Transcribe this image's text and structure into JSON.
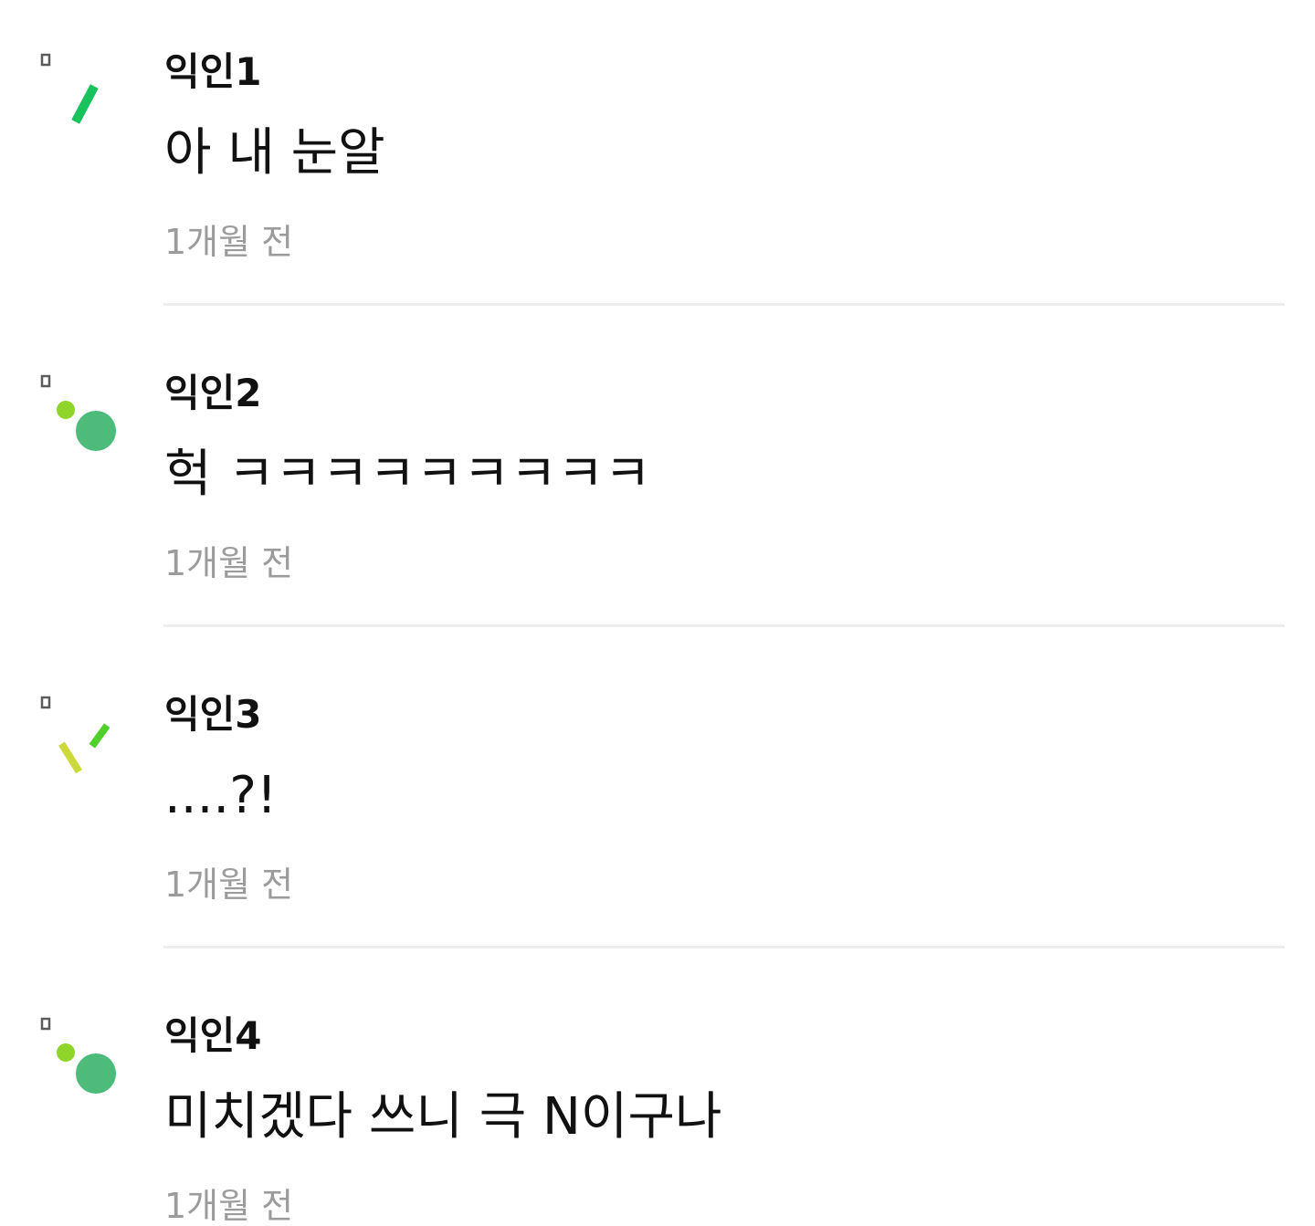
{
  "colors": {
    "author": "#111111",
    "body": "#111111",
    "time": "#9b9b9b",
    "divider": "#eeeeee",
    "avatar_green": "#18c25d",
    "avatar_teal": "#4dbb7a",
    "avatar_lime": "#8fd42a",
    "avatar_yellow": "#cdd93a",
    "avatar_corner": "#5a5a5a"
  },
  "comments": [
    {
      "author": "익인1",
      "text": "아 내 눈알",
      "time": "1개월 전",
      "avatar_icon": "green-slash-avatar-icon"
    },
    {
      "author": "익인2",
      "text": "헉 ㅋㅋㅋㅋㅋㅋㅋㅋㅋ",
      "time": "1개월 전",
      "avatar_icon": "two-dots-avatar-icon"
    },
    {
      "author": "익인3",
      "text": "....?!",
      "time": "1개월 전",
      "avatar_icon": "two-slashes-avatar-icon"
    },
    {
      "author": "익인4",
      "text": "미치겠다 쓰니 극 N이구나",
      "time": "1개월 전",
      "avatar_icon": "two-dots-avatar-icon"
    }
  ]
}
